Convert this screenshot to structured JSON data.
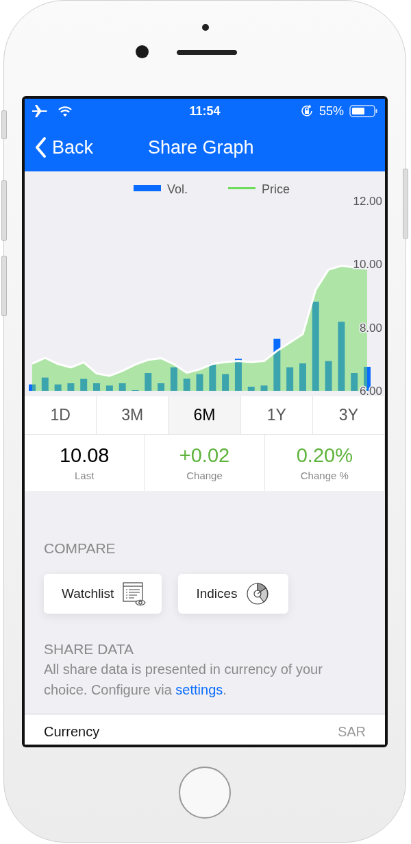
{
  "status_bar": {
    "time": "11:54",
    "battery": "55%"
  },
  "nav": {
    "back": "Back",
    "title": "Share Graph"
  },
  "chart": {
    "volume_legend": {
      "label": "Vol.",
      "color": "#0a6cff"
    },
    "chart_data": {
      "type": "area",
      "ylim": [
        6,
        12
      ],
      "yticks": [
        {
          "value": 12,
          "label": "12.00"
        },
        {
          "value": 10,
          "label": "10.00"
        },
        {
          "value": 8,
          "label": "8.00"
        },
        {
          "value": 6,
          "label": "6.00"
        }
      ],
      "series": [
        {
          "name": "Price",
          "color": "#6ddc5a",
          "values": [
            6.86,
            7.04,
            6.85,
            6.74,
            6.9,
            6.55,
            6.47,
            6.63,
            6.83,
            6.98,
            7.03,
            6.84,
            6.57,
            6.68,
            6.85,
            6.91,
            6.94,
            6.91,
            6.94,
            7.26,
            7.53,
            7.79,
            9.19,
            9.83,
            9.95,
            9.9,
            9.86
          ]
        }
      ]
    }
  },
  "periods": [
    {
      "label": "1D",
      "selected": false
    },
    {
      "label": "3M",
      "selected": false
    },
    {
      "label": "6M",
      "selected": true
    },
    {
      "label": "1Y",
      "selected": false
    },
    {
      "label": "3Y",
      "selected": false
    }
  ],
  "stats": [
    {
      "value": "10.08",
      "label": "Last",
      "color": "#000000"
    },
    {
      "value": "+0.02",
      "label": "Change",
      "color": "#5eb33c"
    },
    {
      "value": "0.20%",
      "label": "Change %",
      "color": "#5eb33c"
    }
  ],
  "compare": {
    "title": "COMPARE",
    "buttons": [
      {
        "label": "Watchlist",
        "kind": "watchlist"
      },
      {
        "label": "Indices",
        "kind": "indices"
      }
    ]
  },
  "share_data": {
    "title": "SHARE DATA",
    "text": "All share data is presented in currency of your choice. Configure via ",
    "link": "settings",
    "after": "."
  },
  "rows": [
    {
      "label": "Currency",
      "value": "SAR"
    }
  ]
}
